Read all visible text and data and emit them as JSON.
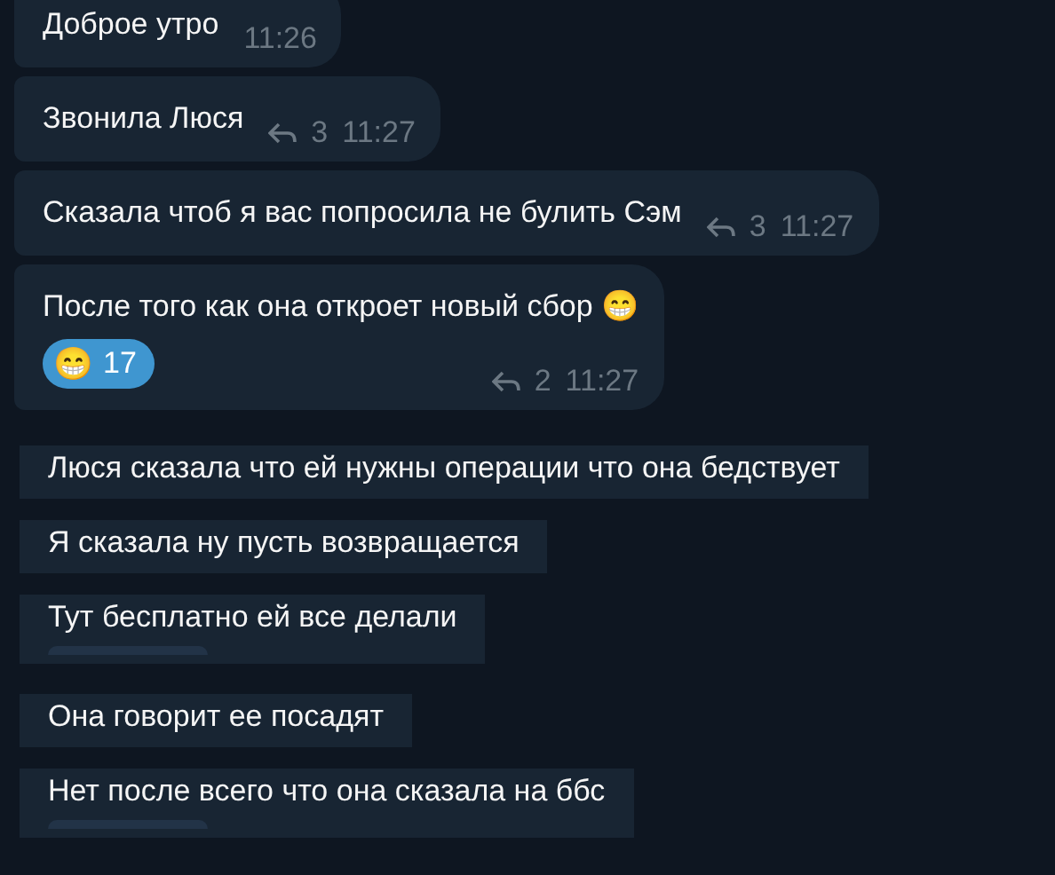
{
  "messages": [
    {
      "text": "Доброе утро",
      "time": "11:26"
    },
    {
      "text": "Звонила Люся",
      "replies": "3",
      "time": "11:27"
    },
    {
      "text": "Сказала чтоб я вас попросила не булить Сэм",
      "replies": "3",
      "time": "11:27"
    },
    {
      "text": "После того как она откроет новый сбор 😁",
      "replies": "2",
      "time": "11:27",
      "reaction": {
        "emoji": "😁",
        "count": "17"
      }
    }
  ],
  "clips": [
    {
      "text": "Люся сказала что ей нужны операции что она бедствует",
      "cut_reaction": false
    },
    {
      "text": "Я сказала ну пусть возвращается",
      "cut_reaction": false
    },
    {
      "text": "Тут бесплатно ей все делали",
      "cut_reaction": true
    },
    {
      "text": "Она говорит ее посадят",
      "cut_reaction": false
    },
    {
      "text": "Нет после всего что она сказала на ббс",
      "cut_reaction": true
    }
  ]
}
